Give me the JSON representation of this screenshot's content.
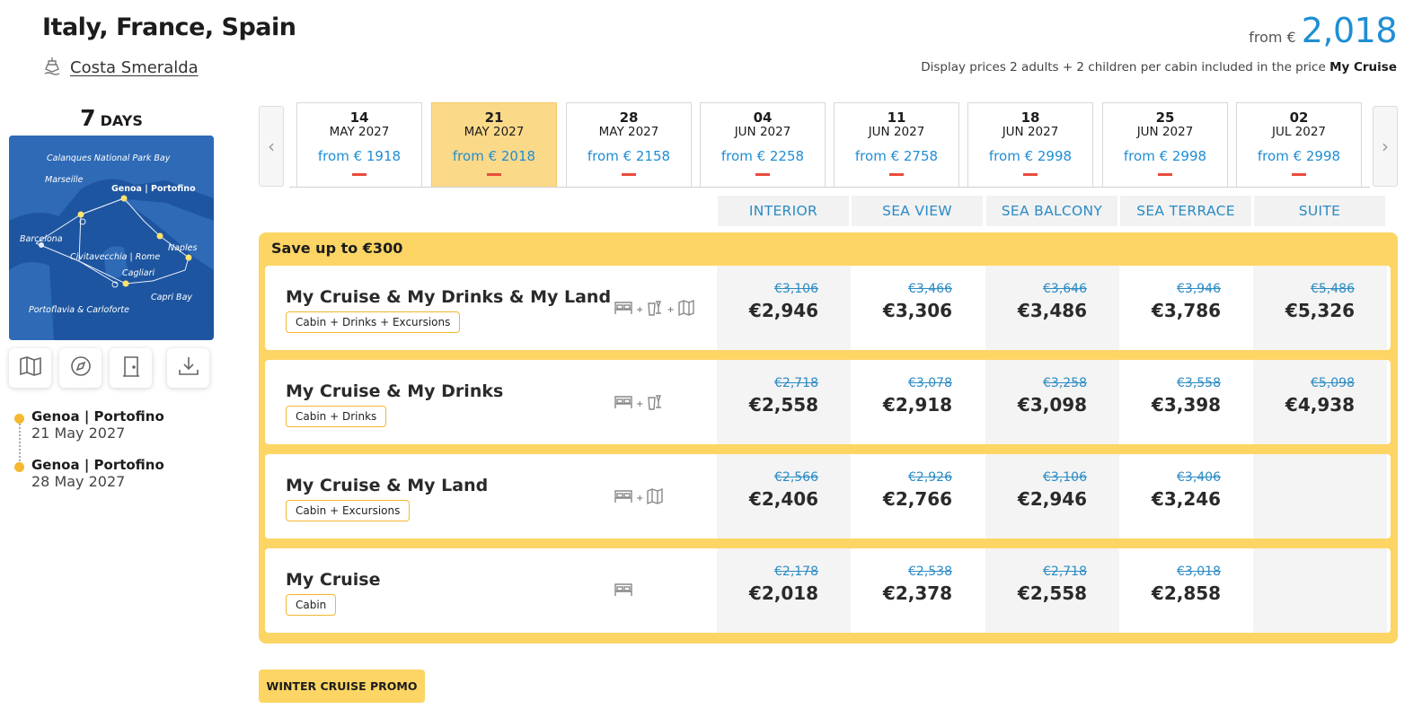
{
  "header": {
    "title": "Italy, France, Spain",
    "ship_name": "Costa Smeralda",
    "price_from_label": "from €",
    "price_from_value": "2,018",
    "display_note": "Display prices 2 adults + 2 children per cabin included in the price",
    "display_note_bold": "My Cruise"
  },
  "itinerary": {
    "days_number": "7",
    "days_label": "DAYS",
    "map_labels": {
      "calanques": "Calanques National Park Bay",
      "marseille": "Marseille",
      "genoa": "Genoa | Portofino",
      "barcelona": "Barcelona",
      "naples": "Naples",
      "civitavecchia": "Civitavecchia | Rome",
      "cagliari": "Cagliari",
      "capri": "Capri Bay",
      "portoflavia": "Portoflavia & Carloforte"
    },
    "tools": [
      "map-icon",
      "compass-icon",
      "door-icon",
      "download-icon"
    ],
    "stops": [
      {
        "port": "Genoa | Portofino",
        "date": "21 May 2027"
      },
      {
        "port": "Genoa | Portofino",
        "date": "28 May 2027"
      }
    ]
  },
  "dates": [
    {
      "day": "14",
      "month": "MAY 2027",
      "from": "from € 1918",
      "selected": false
    },
    {
      "day": "21",
      "month": "MAY 2027",
      "from": "from € 2018",
      "selected": true
    },
    {
      "day": "28",
      "month": "MAY 2027",
      "from": "from € 2158",
      "selected": false
    },
    {
      "day": "04",
      "month": "JUN 2027",
      "from": "from € 2258",
      "selected": false
    },
    {
      "day": "11",
      "month": "JUN 2027",
      "from": "from € 2758",
      "selected": false
    },
    {
      "day": "18",
      "month": "JUN 2027",
      "from": "from € 2998",
      "selected": false
    },
    {
      "day": "25",
      "month": "JUN 2027",
      "from": "from € 2998",
      "selected": false
    },
    {
      "day": "02",
      "month": "JUL 2027",
      "from": "from € 2998",
      "selected": false
    }
  ],
  "cabin_types": [
    "INTERIOR",
    "SEA VIEW",
    "SEA BALCONY",
    "SEA TERRACE",
    "SUITE"
  ],
  "offer": {
    "save_label": "Save up to €300",
    "packages": [
      {
        "name": "My Cruise & My Drinks & My Land",
        "tag": "Cabin + Drinks + Excursions",
        "icons": [
          "bed-icon",
          "drinks-icon",
          "map-icon"
        ],
        "prices": [
          {
            "old": "€3,106",
            "now": "€2,946"
          },
          {
            "old": "€3,466",
            "now": "€3,306"
          },
          {
            "old": "€3,646",
            "now": "€3,486"
          },
          {
            "old": "€3,946",
            "now": "€3,786"
          },
          {
            "old": "€5,486",
            "now": "€5,326"
          }
        ]
      },
      {
        "name": "My Cruise & My Drinks",
        "tag": "Cabin + Drinks",
        "icons": [
          "bed-icon",
          "drinks-icon"
        ],
        "prices": [
          {
            "old": "€2,718",
            "now": "€2,558"
          },
          {
            "old": "€3,078",
            "now": "€2,918"
          },
          {
            "old": "€3,258",
            "now": "€3,098"
          },
          {
            "old": "€3,558",
            "now": "€3,398"
          },
          {
            "old": "€5,098",
            "now": "€4,938"
          }
        ]
      },
      {
        "name": "My Cruise & My Land",
        "tag": "Cabin + Excursions",
        "icons": [
          "bed-icon",
          "map-icon"
        ],
        "prices": [
          {
            "old": "€2,566",
            "now": "€2,406"
          },
          {
            "old": "€2,926",
            "now": "€2,766"
          },
          {
            "old": "€3,106",
            "now": "€2,946"
          },
          {
            "old": "€3,406",
            "now": "€3,246"
          },
          {
            "old": "",
            "now": ""
          }
        ]
      },
      {
        "name": "My Cruise",
        "tag": "Cabin",
        "icons": [
          "bed-icon"
        ],
        "prices": [
          {
            "old": "€2,178",
            "now": "€2,018"
          },
          {
            "old": "€2,538",
            "now": "€2,378"
          },
          {
            "old": "€2,718",
            "now": "€2,558"
          },
          {
            "old": "€3,018",
            "now": "€2,858"
          },
          {
            "old": "",
            "now": ""
          }
        ]
      }
    ]
  },
  "promo_button": "WINTER CRUISE PROMO",
  "colors": {
    "accent_blue": "#1f8ed4",
    "promo_yellow": "#fcd565",
    "selected_date": "#fad989",
    "dash_red": "#e94b3c"
  }
}
